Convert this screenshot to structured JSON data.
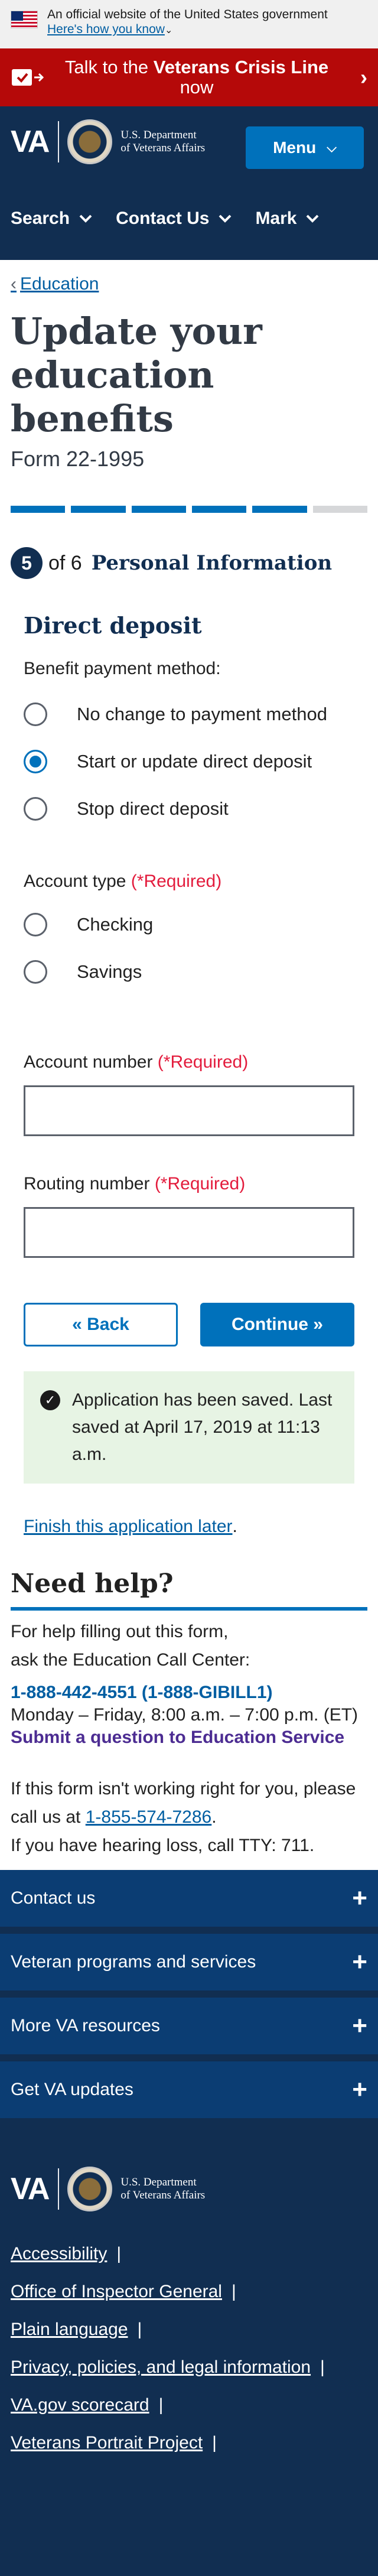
{
  "official_banner": {
    "text": "An official website of the United States government",
    "link": "Here's how you know"
  },
  "crisis": {
    "prefix": "Talk to the",
    "emphasis": "Veterans Crisis Line",
    "suffix": "now"
  },
  "header": {
    "logo_text": "VA",
    "dept_line1": "U.S. Department",
    "dept_line2": "of Veterans Affairs",
    "menu_label": "Menu"
  },
  "nav": {
    "items": [
      "Search",
      "Contact Us",
      "Mark"
    ]
  },
  "breadcrumb": {
    "label": "Education"
  },
  "page": {
    "title": "Update your education benefits",
    "form_number": "Form 22-1995",
    "progress_total": 6,
    "progress_current": 5,
    "step_number": "5",
    "step_of": "of 6",
    "step_title": "Personal Information"
  },
  "direct_deposit": {
    "title": "Direct deposit",
    "payment_label": "Benefit payment method:",
    "options": [
      "No change to payment method",
      "Start or update direct deposit",
      "Stop direct deposit"
    ],
    "selected_index": 1
  },
  "account_type": {
    "label": "Account type",
    "required": "(*Required)",
    "options": [
      "Checking",
      "Savings"
    ]
  },
  "account_number": {
    "label": "Account number",
    "required": "(*Required)",
    "value": ""
  },
  "routing_number": {
    "label": "Routing number",
    "required": "(*Required)",
    "value": ""
  },
  "buttons": {
    "back": "« Back",
    "continue": "Continue »"
  },
  "saved": {
    "message": "Application has been saved. Last saved at April 17, 2019 at 11:13 a.m."
  },
  "finish_later": "Finish this application later",
  "help": {
    "title": "Need help?",
    "intro_line1": "For help filling out this form,",
    "intro_line2": "ask the Education Call Center:",
    "phone": "1-888-442-4551 (1-888-GIBILL1)",
    "hours": "Monday – Friday, 8:00 a.m. – 7:00 p.m. (ET)",
    "submit_question": "Submit a question to Education Service",
    "issue_line1": "If this form isn't working right for you, please",
    "issue_prefix": "call us at",
    "issue_phone": "1-855-574-7286",
    "tty": "If you have hearing loss, call TTY: 711."
  },
  "footer": {
    "accordions": [
      "Contact us",
      "Veteran programs and services",
      "More VA resources",
      "Get VA updates"
    ],
    "links": [
      "Accessibility",
      "Office of Inspector General",
      "Plain language",
      "Privacy, policies, and legal information",
      "VA.gov scorecard",
      "Veterans Portrait Project"
    ]
  }
}
